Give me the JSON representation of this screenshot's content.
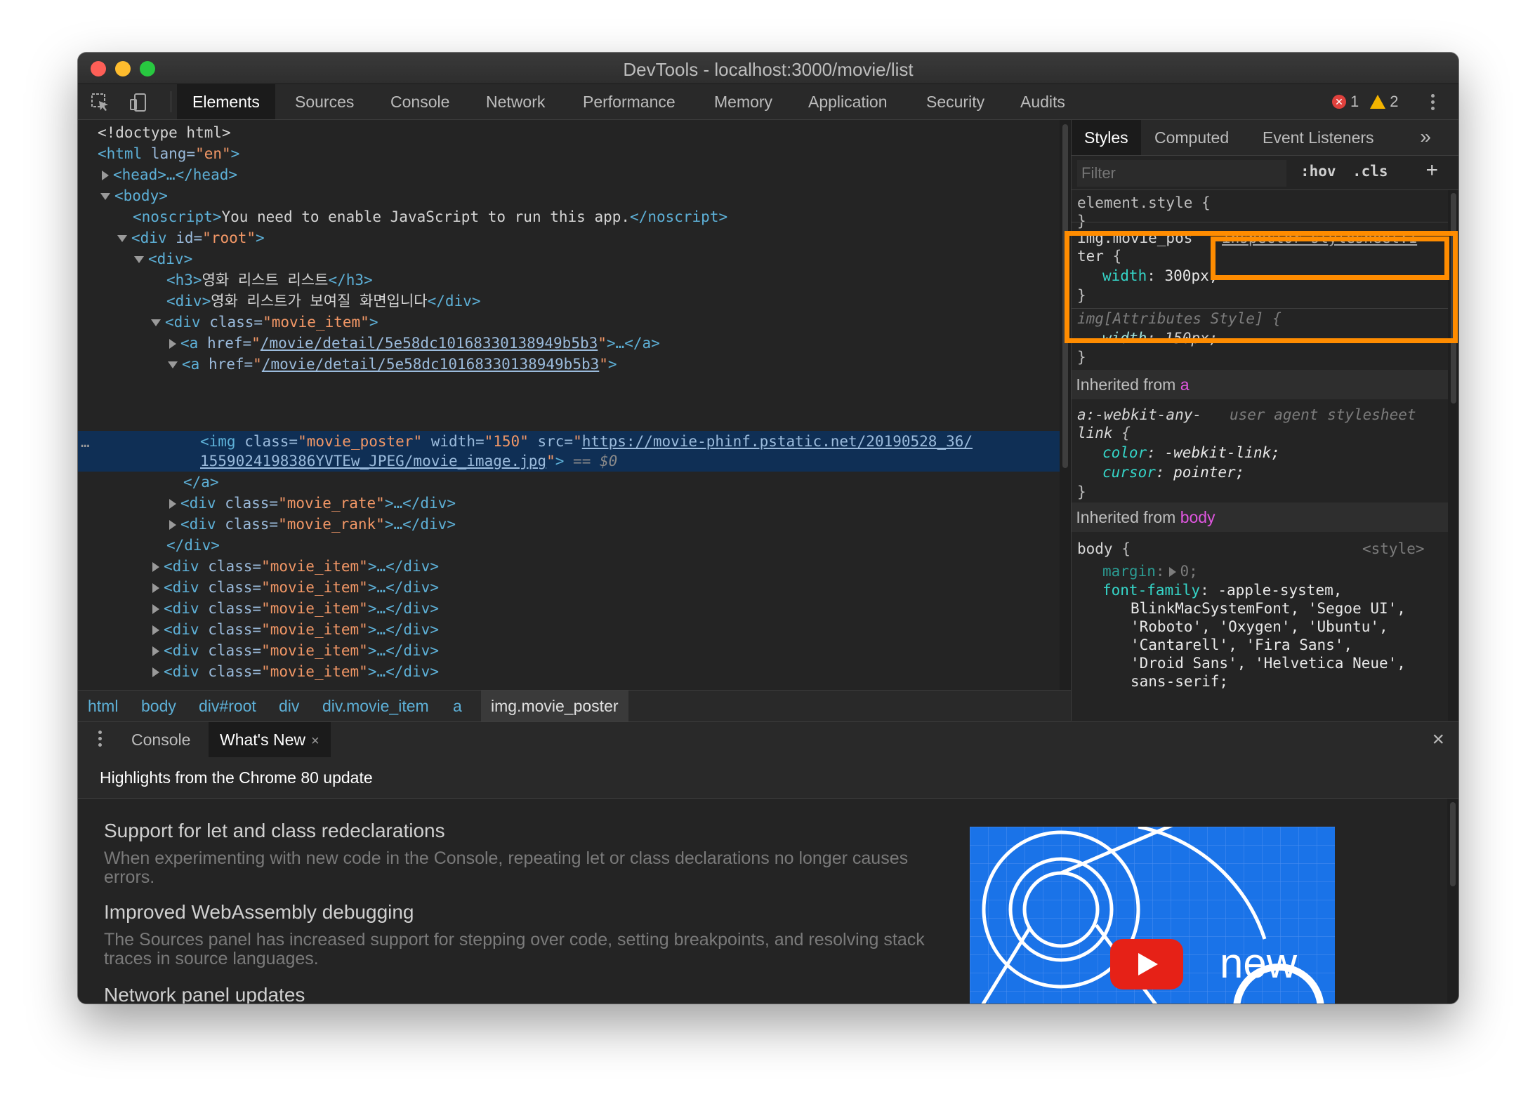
{
  "window": {
    "title": "DevTools - localhost:3000/movie/list"
  },
  "toolbar": {
    "tabs": [
      "Elements",
      "Sources",
      "Console",
      "Network",
      "Performance",
      "Memory",
      "Application",
      "Security",
      "Audits"
    ],
    "error_count": "1",
    "warning_count": "2"
  },
  "dom": {
    "doctype": "<!doctype html>",
    "html_open_tag": "<html",
    "html_lang_attr": " lang=",
    "html_lang_val": "\"en\"",
    "html_close": ">",
    "head_collapsed": "<head>…</head>",
    "body_open": "<body>",
    "noscript_open": "<noscript>",
    "noscript_text": "You need to enable JavaScript to run this app.",
    "noscript_close": "</noscript>",
    "div_root_tag": "<div",
    "div_root_attr": " id=",
    "div_root_val": "\"root\"",
    "div_open": "<div>",
    "h3_open": "<h3>",
    "h3_text": "영화 리스트 리스트",
    "h3_close": "</h3>",
    "div_text_open": "<div>",
    "div_text": "영화 리스트가 보여질 화면입니다",
    "div_text_close": "</div>",
    "movie_item_tag": "<div",
    "class_attr": " class=",
    "movie_item_val": "\"movie_item\"",
    "gt": ">",
    "a_tag": "<a",
    "href_attr": " href=",
    "href_q_open": "\"",
    "href_val": "/movie/detail/5e58dc10168330138949b5b3",
    "href_q_close": "\"",
    "a_collapsed_end": ">…</a>",
    "img_tag": "<img",
    "img_class_val": "\"movie_poster\"",
    "width_attr": " width=",
    "width_val": "\"150\"",
    "src_attr": " src=",
    "src_line1": "https://movie-phinf.pstatic.net/20190528_36/",
    "src_line2": "1559024198386YVTEw_JPEG/movie_image.jpg",
    "dollar0": " == $0",
    "a_close": "</a>",
    "movie_rate_val": "\"movie_rate\"",
    "movie_rank_val": "\"movie_rank\"",
    "collapsed_div_end": ">…</div>",
    "div_close": "</div>",
    "ellipsis": "…"
  },
  "breadcrumbs": [
    "html",
    "body",
    "div#root",
    "div",
    "div.movie_item",
    "a",
    "img.movie_poster"
  ],
  "styles": {
    "tabs": [
      "Styles",
      "Computed",
      "Event Listeners"
    ],
    "more_tabs": "»",
    "filter_placeholder": "Filter",
    "hov": ":hov",
    "cls": ".cls",
    "add": "+",
    "element_style": "element.style {",
    "close_brace": "}",
    "rule1_sel_a": "img.movie_pos",
    "rule1_sel_b": "ter",
    "open_brace": " {",
    "rule1_source": "inspector-stylesheet:1",
    "rule1_prop": "width",
    "rule1_val": "300px;",
    "rule2_sel": "img[Attributes Style] {",
    "rule2_prop": "width",
    "rule2_val": "150px;",
    "inherited_from": "Inherited from ",
    "inh_a": "a",
    "rule3_sel_a": "a:-webkit-any-",
    "rule3_sel_b": "link",
    "rule3_source": "user agent stylesheet",
    "rule3_prop1": "color",
    "rule3_val1": "-webkit-link;",
    "rule3_prop2": "cursor",
    "rule3_val2": "pointer;",
    "inh_body": "body",
    "rule4_sel": "body",
    "rule4_source": "<style>",
    "rule4_prop1": "margin",
    "rule4_val1": "0;",
    "rule4_prop2": "font-family",
    "rule4_val2_l1": "-apple-system,",
    "rule4_val2_l2": "BlinkMacSystemFont, 'Segoe UI',",
    "rule4_val2_l3": "'Roboto', 'Oxygen', 'Ubuntu',",
    "rule4_val2_l4": "'Cantarell', 'Fira Sans',",
    "rule4_val2_l5": "'Droid Sans', 'Helvetica Neue',",
    "rule4_val2_l6": "sans-serif;",
    "colon": ": "
  },
  "drawer": {
    "tabs": [
      "Console",
      "What's New"
    ],
    "close_x": "×",
    "highlights": "Highlights from the Chrome 80 update",
    "items": [
      {
        "title": "Support for let and class redeclarations",
        "desc": "When experimenting with new code in the Console, repeating let or class declarations no longer causes errors."
      },
      {
        "title": "Improved WebAssembly debugging",
        "desc": "The Sources panel has increased support for stepping over code, setting breakpoints, and resolving stack traces in source languages."
      },
      {
        "title": "Network panel updates",
        "desc": ""
      }
    ],
    "promo_text": "new"
  },
  "colors": {
    "accent_highlight": "#ff8c00",
    "selected_row": "#0f2f55",
    "tag": "#5db0d7",
    "attr_value": "#f29766"
  }
}
